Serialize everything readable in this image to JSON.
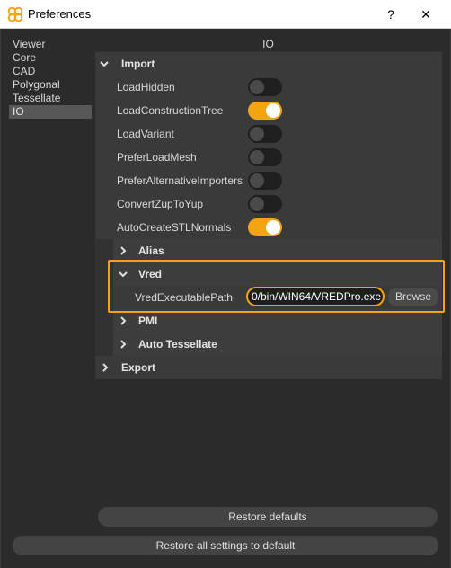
{
  "window": {
    "title": "Preferences",
    "help_label": "?",
    "close_label": "✕",
    "app_icon": "flower-logo-icon"
  },
  "nav": {
    "items": [
      {
        "label": "Viewer",
        "active": false
      },
      {
        "label": "Core",
        "active": false
      },
      {
        "label": "CAD",
        "active": false
      },
      {
        "label": "Polygonal",
        "active": false
      },
      {
        "label": "Tessellate",
        "active": false
      },
      {
        "label": "IO",
        "active": true
      }
    ]
  },
  "panel": {
    "title": "IO",
    "import": {
      "label": "Import",
      "expanded": true,
      "options": [
        {
          "label": "LoadHidden",
          "on": false
        },
        {
          "label": "LoadConstructionTree",
          "on": true
        },
        {
          "label": "LoadVariant",
          "on": false
        },
        {
          "label": "PreferLoadMesh",
          "on": false
        },
        {
          "label": "PreferAlternativeImporters",
          "on": false
        },
        {
          "label": "ConvertZupToYup",
          "on": false
        },
        {
          "label": "AutoCreateSTLNormals",
          "on": true
        }
      ],
      "sub_sections": {
        "alias": {
          "label": "Alias",
          "expanded": false
        },
        "vred": {
          "label": "Vred",
          "expanded": true,
          "path_label": "VredExecutablePath",
          "path_value": "0/bin/WIN64/VREDPro.exe",
          "browse_label": "Browse"
        },
        "pmi": {
          "label": "PMI",
          "expanded": false
        },
        "auto_tessellate": {
          "label": "Auto Tessellate",
          "expanded": false
        }
      }
    },
    "export": {
      "label": "Export",
      "expanded": false
    }
  },
  "buttons": {
    "restore_defaults": "Restore defaults",
    "restore_all": "Restore all settings to default"
  },
  "colors": {
    "accent": "#f2a511",
    "background": "#2b2b2b",
    "panel": "#3a3a3a",
    "toggle_off": "#1f1f1f"
  }
}
